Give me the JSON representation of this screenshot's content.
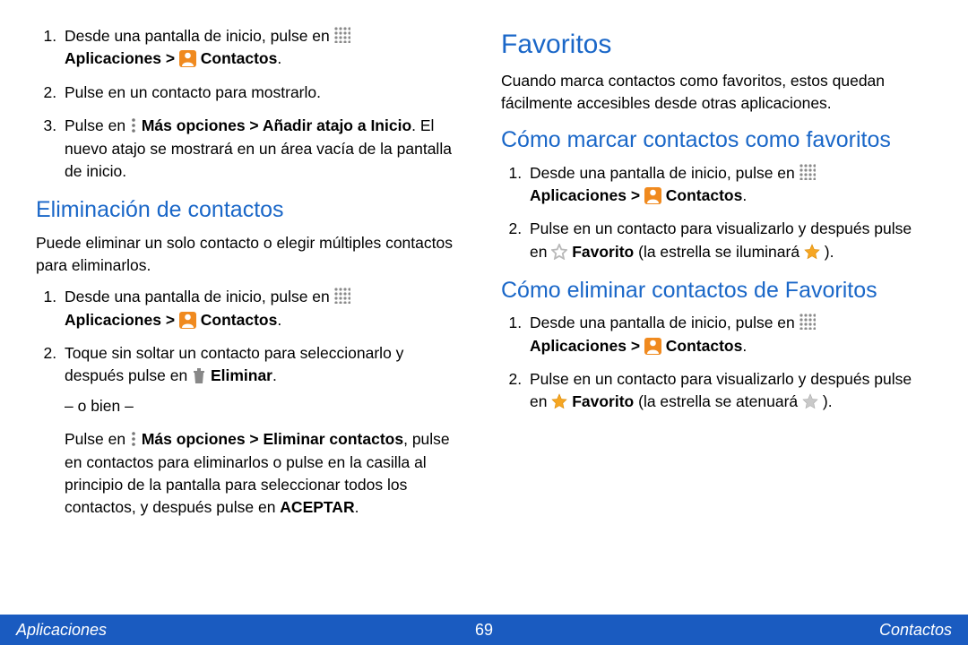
{
  "left": {
    "list1": {
      "i1_a": "Desde una pantalla de inicio, pulse en ",
      "i1_b": "Aplicaciones > ",
      "i1_c": " Contactos",
      "i1_d": ".",
      "i2": "Pulse en un contacto para mostrarlo.",
      "i3_a": "Pulse en ",
      "i3_b": " Más opciones > Añadir atajo a Inicio",
      "i3_c": ". El nuevo atajo se mostrará en un área vacía de la pantalla de inicio."
    },
    "h2": "Eliminación de contactos",
    "p1": "Puede eliminar un solo contacto o elegir múltiples contactos para eliminarlos.",
    "list2": {
      "i1_a": "Desde una pantalla de inicio, pulse en ",
      "i1_b": "Aplicaciones > ",
      "i1_c": " Contactos",
      "i1_d": ".",
      "i2_a": "Toque sin soltar un contacto para seleccionarlo y después pulse en ",
      "i2_b": " Eliminar",
      "i2_c": ".",
      "or": "– o bien –",
      "i2_d": "Pulse en ",
      "i2_e": " Más opciones > Eliminar contactos",
      "i2_f": ", pulse en contactos para eliminarlos o pulse en la casilla al principio de la pantalla para seleccionar todos los contactos, y después pulse en ",
      "i2_g": "ACEPTAR",
      "i2_h": "."
    }
  },
  "right": {
    "h1": "Favoritos",
    "p1": "Cuando marca contactos como favoritos, estos quedan fácilmente accesibles desde otras aplicaciones.",
    "h2a": "Cómo marcar contactos como favoritos",
    "listA": {
      "i1_a": "Desde una pantalla de inicio, pulse en ",
      "i1_b": "Aplicaciones > ",
      "i1_c": " Contactos",
      "i1_d": ".",
      "i2_a": "Pulse en un contacto para visualizarlo y después pulse en ",
      "i2_b": " Favorito",
      "i2_c": " (la estrella se iluminará ",
      "i2_d": " )."
    },
    "h2b": "Cómo eliminar contactos de Favoritos",
    "listB": {
      "i1_a": "Desde una pantalla de inicio, pulse en ",
      "i1_b": "Aplicaciones > ",
      "i1_c": " Contactos",
      "i1_d": ".",
      "i2_a": "Pulse en un contacto para visualizarlo y después pulse en ",
      "i2_b": " Favorito",
      "i2_c": " (la estrella se atenuará ",
      "i2_d": " )."
    }
  },
  "footer": {
    "left": "Aplicaciones",
    "center": "69",
    "right": "Contactos"
  }
}
